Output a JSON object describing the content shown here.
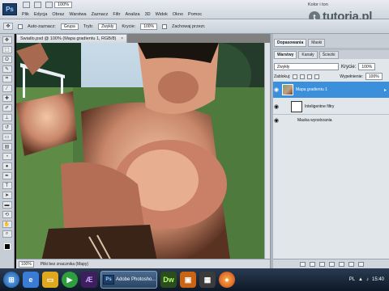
{
  "app": {
    "logo": "Ps",
    "zoom": "100%",
    "workspace_label": "Kolor i ton",
    "menus": [
      "Plik",
      "Edycja",
      "Obraz",
      "Warstwa",
      "Zaznacz",
      "Filtr",
      "Analiza",
      "3D",
      "Widok",
      "Okno",
      "Pomoc"
    ]
  },
  "watermark": {
    "logo_letter": "t",
    "text": "tutoria.pl"
  },
  "options": {
    "auto_select": "Auto-zaznacz:",
    "group": "Grupa",
    "mode_label": "Tryb:",
    "mode_value": "Zwykły",
    "opacity_label": "Krycie:",
    "opacity_value": "100%",
    "erase_label": "Zachowaj przezr."
  },
  "document": {
    "tab_title": "Swiatlo.psd @ 100% (Mapa gradientu 1, RGB/8)",
    "close": "×",
    "zoom": "100%",
    "status": "Pliki bez znacznika (Mapy)"
  },
  "panels": {
    "top_tabs": [
      "Dopasowania",
      "Maski"
    ],
    "layer_tabs": [
      "Warstwy",
      "Kanały",
      "Ścieżki"
    ],
    "blend_mode": "Zwykły",
    "opacity_label": "Krycie:",
    "opacity_value": "100%",
    "lock_label": "Zablokuj:",
    "fill_label": "Wypełnienie:",
    "fill_value": "100%",
    "layers": [
      {
        "name": "Mapa gradientu 1",
        "selected": true
      },
      {
        "name": "Inteligentne filtry",
        "selected": false
      },
      {
        "name": "Maska wyostrzania",
        "selected": false
      }
    ]
  },
  "taskbar": {
    "active_window": "Adobe Photosho...",
    "lang": "PL",
    "clock": "15:40"
  },
  "colors": {
    "accent": "#3c8fdb",
    "chrome": "#c6cdd5"
  }
}
